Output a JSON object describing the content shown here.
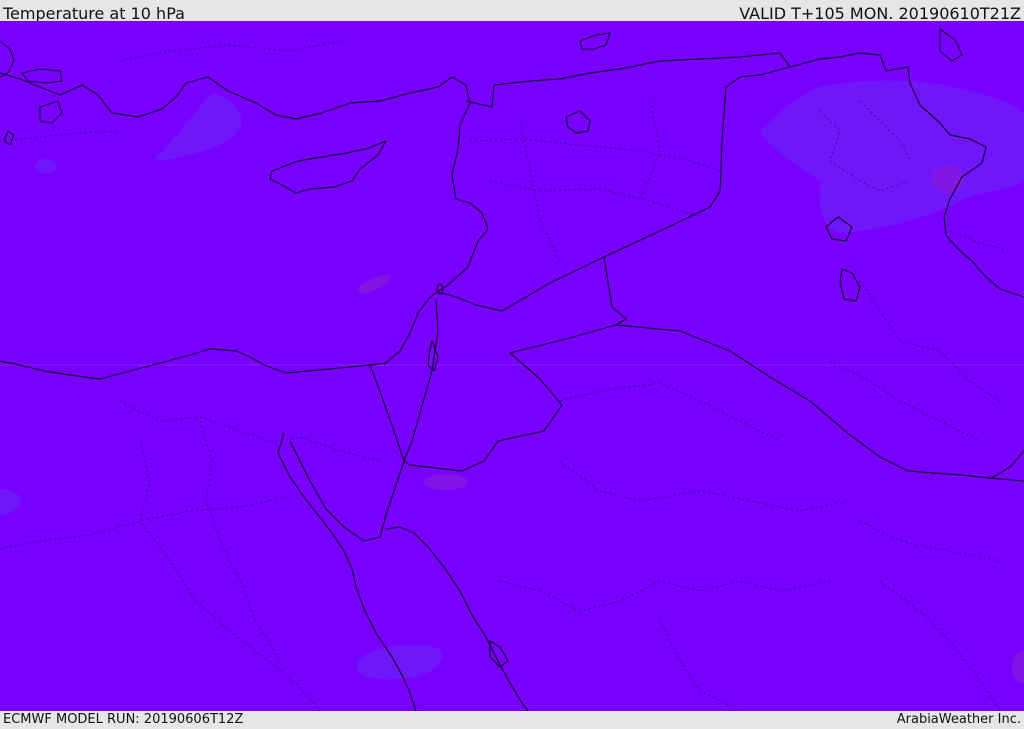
{
  "header": {
    "title": "Temperature at 10 hPa",
    "valid": "VALID T+105 MON. 20190610T21Z"
  },
  "footer": {
    "model_run": "ECMWF MODEL RUN: 20190606T12Z",
    "credit": "ArabiaWeather Inc."
  },
  "colors": {
    "field_base": "#7800ff",
    "field_cooler": "#6a2af5",
    "field_warmer": "#8a1ad8",
    "coastline": "#000000"
  }
}
